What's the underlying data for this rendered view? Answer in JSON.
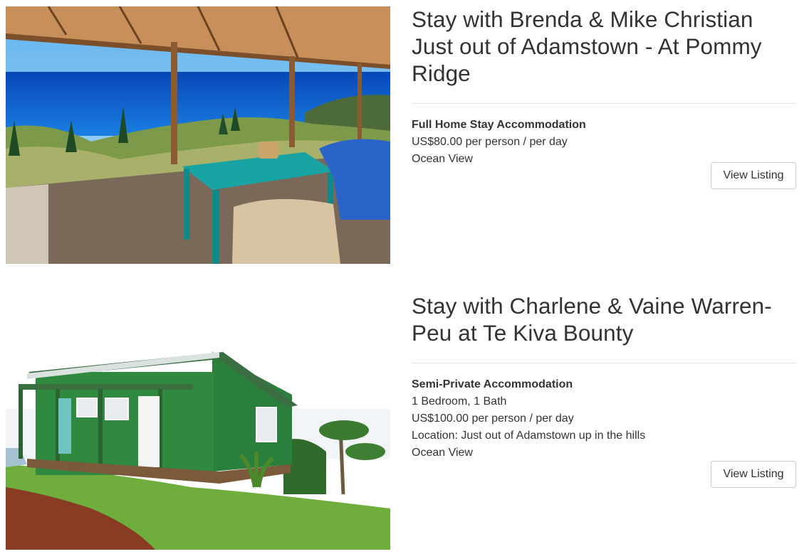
{
  "listings": [
    {
      "title": "Stay with Brenda & Mike Christian Just out of Adamstown - At Pommy Ridge",
      "type": "Full Home Stay Accommodation",
      "details": [
        "US$80.00 per person / per day",
        "Ocean View"
      ],
      "button_label": "View Listing"
    },
    {
      "title": "Stay with Charlene & Vaine Warren-Peu at Te Kiva Bounty",
      "type": "Semi-Private Accommodation",
      "details": [
        "1 Bedroom, 1 Bath",
        "US$100.00 per person / per day",
        "Location: Just out of Adamstown up in the hills",
        "Ocean View"
      ],
      "button_label": "View Listing"
    }
  ],
  "colors": {
    "text": "#333333",
    "divider": "#e4e4e4",
    "button_border": "#cccccc",
    "ocean": "#0a5fd0",
    "house_green": "#2f7d3a"
  }
}
